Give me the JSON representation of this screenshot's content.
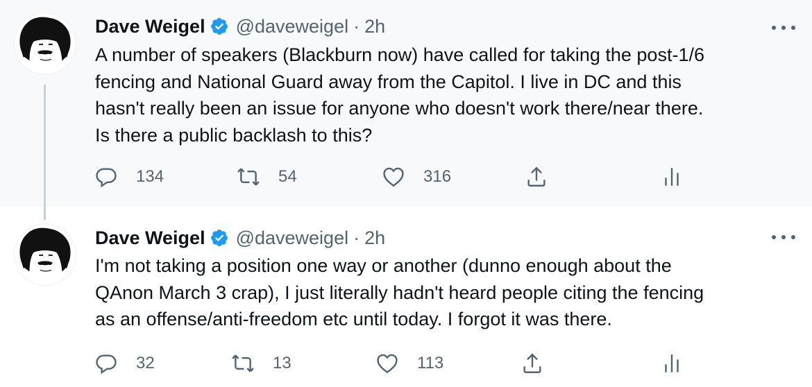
{
  "tweets": [
    {
      "author": {
        "name": "Dave Weigel",
        "handle": "@daveweigel",
        "separator": "·",
        "time": "2h"
      },
      "lines": [
        "A number of speakers (Blackburn now) have called for taking the post-1/6",
        "fencing and National Guard away from the Capitol. I live in DC and this",
        "hasn't really been an issue for anyone who doesn't work there/near there.",
        "Is there a public backlash to this?"
      ],
      "stats": {
        "replies": "134",
        "retweets": "54",
        "likes": "316"
      }
    },
    {
      "author": {
        "name": "Dave Weigel",
        "handle": "@daveweigel",
        "separator": "·",
        "time": "2h"
      },
      "lines": [
        "I'm not taking a position one way or another (dunno enough about the",
        "QAnon March 3 crap), I just literally hadn't heard people citing the fencing",
        "as an offense/anti-freedom etc until today. I forgot it was there."
      ],
      "stats": {
        "replies": "32",
        "retweets": "13",
        "likes": "113"
      }
    }
  ],
  "icons": {
    "verified": "verified-badge-icon",
    "reply": "reply-icon",
    "retweet": "retweet-icon",
    "like": "heart-icon",
    "share": "share-icon",
    "analytics": "analytics-icon",
    "more": "more-options-icon"
  },
  "colors": {
    "verified": "#1d9bf0",
    "icon_gray": "#536471",
    "thread_line": "#c4cfd6",
    "first_tweet_bg": "#f7f9fa"
  }
}
